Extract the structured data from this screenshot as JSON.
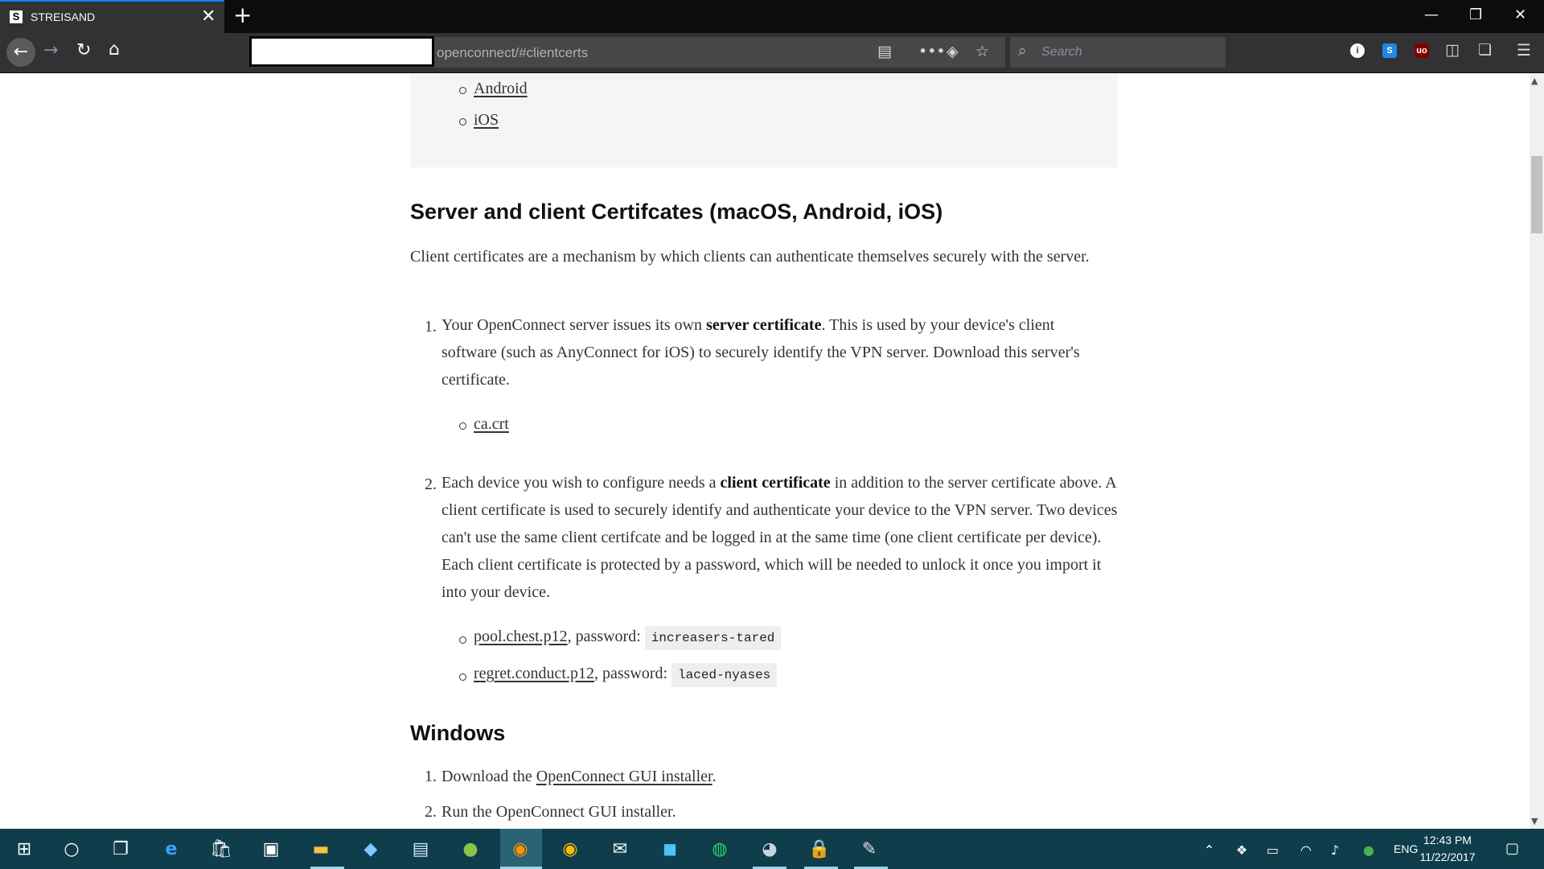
{
  "browser": {
    "tab_title": "STREISAND",
    "tab_favicon": "S",
    "url_visible": "openconnect/#clientcerts",
    "search_placeholder": "Search"
  },
  "page": {
    "top_list": [
      "Android",
      "iOS"
    ],
    "section1": {
      "heading": "Server and client Certifcates (macOS, Android, iOS)",
      "intro": "Client certificates are a mechanism by which clients can authenticate themselves securely with the server.",
      "item1_num": "1.",
      "item1_pre": "Your OpenConnect server issues its own ",
      "item1_bold": "server certificate",
      "item1_post": ". This is used by your device's client software (such as AnyConnect for iOS) to securely identify the VPN server. Download this server's certificate.",
      "item1_file": "ca.crt",
      "item2_num": "2.",
      "item2_pre": "Each device you wish to configure needs a ",
      "item2_bold": "client certificate",
      "item2_post": " in addition to the server certificate above. A client certificate is used to securely identify and authenticate your device to the VPN server. Two devices can't use the same client certifcate and be logged in at the same time (one client certificate per device). Each client certificate is protected by a password, which will be needed to unlock it once you import it into your device.",
      "password_label": ", password:",
      "certs": [
        {
          "file": "pool.chest.p12",
          "password": "increasers-tared"
        },
        {
          "file": "regret.conduct.p12",
          "password": "laced-nyases"
        }
      ]
    },
    "section2": {
      "heading": "Windows",
      "step1_num": "1.",
      "step1_pre": "Download the ",
      "step1_link": "OpenConnect GUI installer",
      "step1_post": ".",
      "step2_num": "2.",
      "step2_text": "Run the OpenConnect GUI installer."
    }
  },
  "taskbar": {
    "language": "ENG",
    "time": "12:43 PM",
    "date": "11/22/2017"
  }
}
